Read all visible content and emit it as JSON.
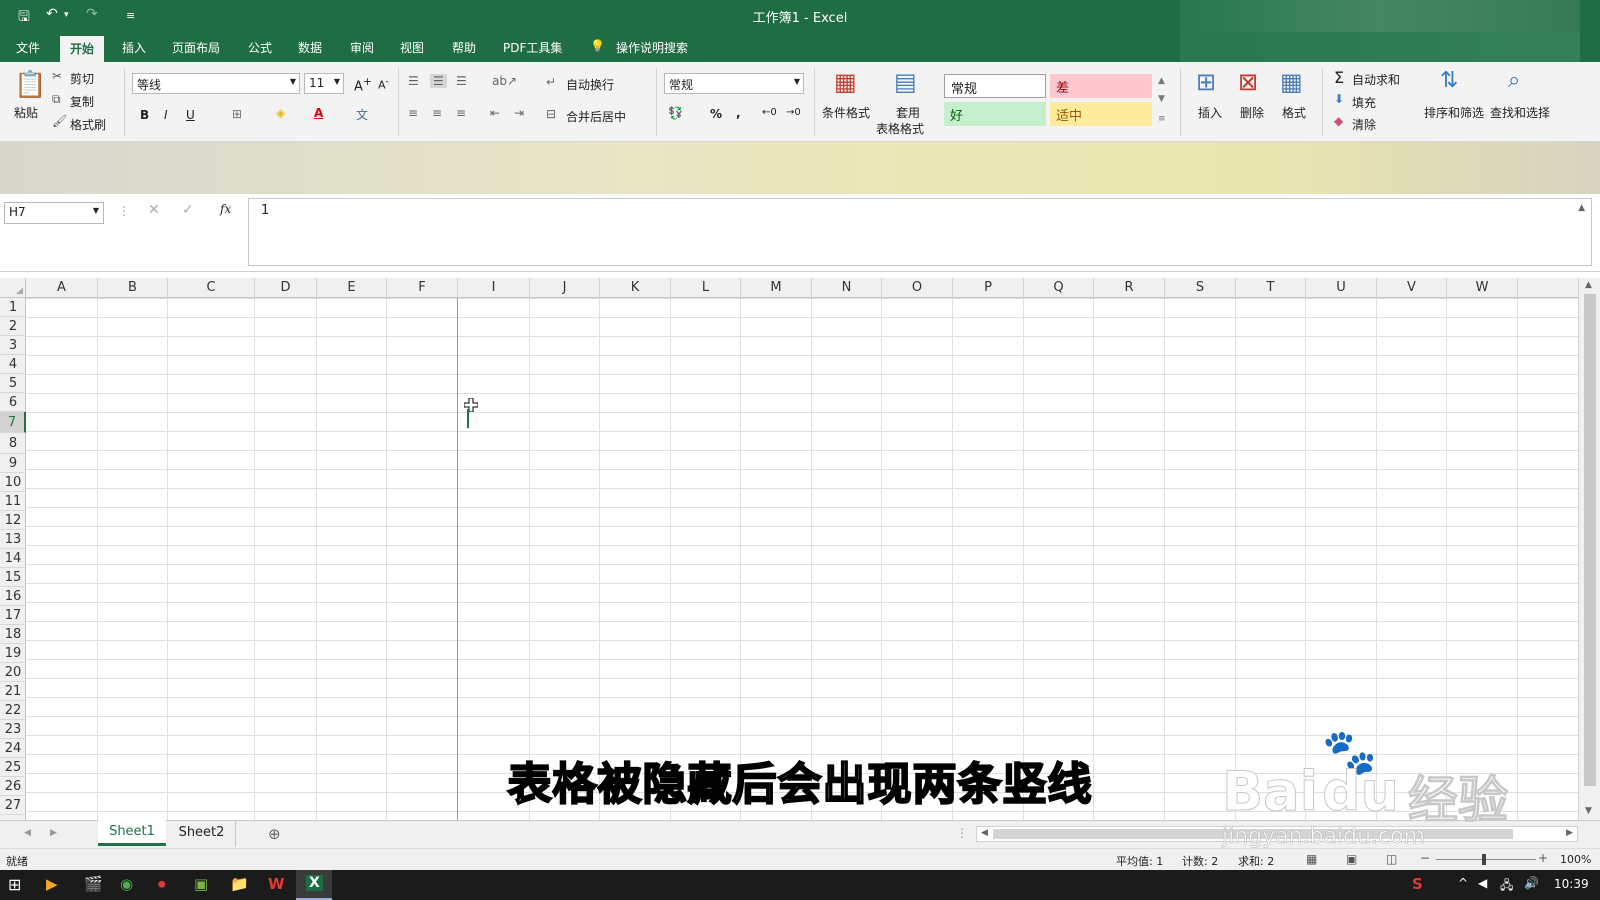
{
  "window": {
    "title": "工作簿1  -  Excel"
  },
  "menu": {
    "file": "文件",
    "home": "开始",
    "insert": "插入",
    "page_layout": "页面布局",
    "formulas": "公式",
    "data": "数据",
    "review": "审阅",
    "view": "视图",
    "help": "帮助",
    "pdf_tools": "PDF工具集",
    "tell_me": "操作说明搜索"
  },
  "ribbon": {
    "paste": "粘贴",
    "cut": "剪切",
    "copy": "复制",
    "format_painter": "格式刷",
    "font_name": "等线",
    "font_size": "11",
    "bold": "B",
    "italic": "I",
    "underline": "U",
    "wrap_text": "自动换行",
    "merge_center": "合并后居中",
    "number_format": "常规",
    "conditional_format": "条件格式",
    "table_format_line1": "套用",
    "table_format_line2": "表格格式",
    "styles": {
      "normal": "常规",
      "bad": "差",
      "good": "好",
      "neutral": "适中"
    },
    "insert": "插入",
    "delete": "删除",
    "format": "格式",
    "autosum": "自动求和",
    "fill": "填充",
    "clear": "清除",
    "sort_filter": "排序和筛选",
    "find_select": "查找和选择"
  },
  "formula_bar": {
    "name_box": "H7",
    "fx": "fx",
    "value": "1"
  },
  "columns": [
    "A",
    "B",
    "C",
    "D",
    "E",
    "F",
    "I",
    "J",
    "K",
    "L",
    "M",
    "N",
    "O",
    "P",
    "Q",
    "R",
    "S",
    "T",
    "U",
    "V",
    "W"
  ],
  "rows": [
    "1",
    "2",
    "3",
    "4",
    "5",
    "6",
    "7",
    "8",
    "9",
    "10",
    "11",
    "12",
    "13",
    "14",
    "15",
    "16",
    "17",
    "18",
    "19",
    "20",
    "21",
    "22",
    "23",
    "24",
    "25",
    "26",
    "27"
  ],
  "sheets": {
    "sheet1": "Sheet1",
    "sheet2": "Sheet2"
  },
  "status": {
    "ready": "就绪",
    "average": "平均值: 1",
    "count": "计数: 2",
    "sum": "求和: 2",
    "zoom": "100%"
  },
  "taskbar": {
    "time": "10:39"
  },
  "subtitle": "表格被隐藏后会出现两条竖线",
  "watermark": {
    "brand": "Bai",
    "du": "du",
    "cn": "经验",
    "url": "jingyan.baidu.com"
  },
  "colors": {
    "excel_green": "#1f6e43",
    "bad_bg": "#ffc7ce",
    "bad_fg": "#9c0006",
    "good_bg": "#c6efce",
    "good_fg": "#006100",
    "neutral_bg": "#ffeb9c",
    "neutral_fg": "#9c5700"
  }
}
